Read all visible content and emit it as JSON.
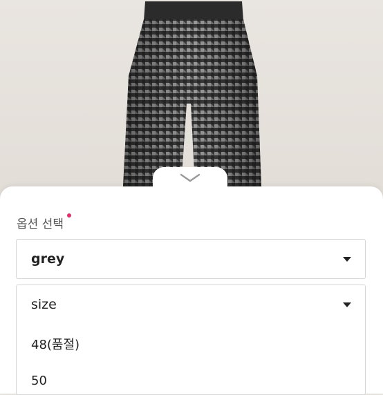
{
  "product": {
    "image_alt": "houndstooth pants"
  },
  "options_sheet": {
    "title": "옵션 선택",
    "color_select": {
      "selected": "grey"
    },
    "size_select": {
      "label": "size",
      "options": [
        "48(품절)",
        "50"
      ]
    }
  },
  "colors": {
    "required": "#e0306a",
    "border": "#d6d6d6"
  }
}
